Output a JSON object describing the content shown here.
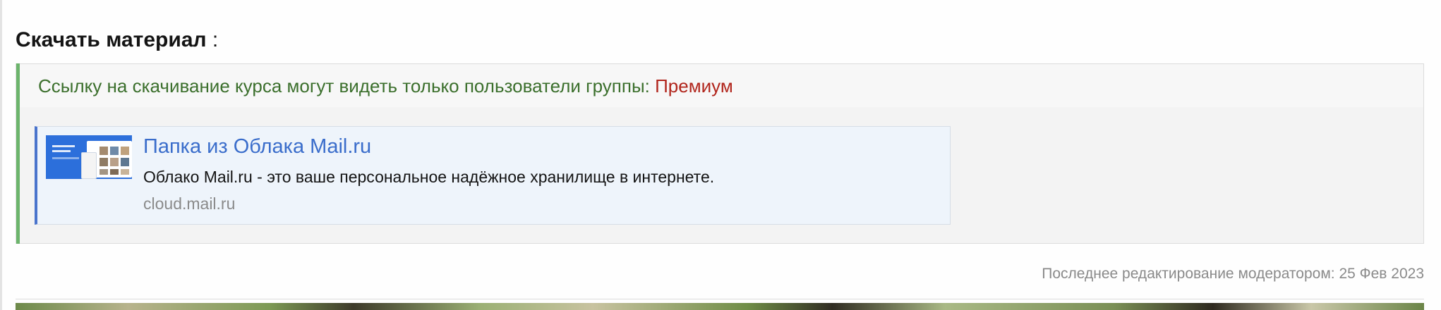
{
  "section": {
    "title": "Скачать материал",
    "title_suffix": " :"
  },
  "hidden_content": {
    "notice_text": "Ссылку на скачивание курса могут видеть только пользователи группы: ",
    "group_name": "Премиум"
  },
  "link_preview": {
    "title": "Папка из Облака Mail.ru",
    "description": "Облако Mail.ru - это ваше персональное надёжное хранилище в интернете.",
    "domain": "cloud.mail.ru",
    "thumbnail_icon": "cloud-preview-thumbnail"
  },
  "footer": {
    "last_edit": "Последнее редактирование модератором: 25 Фев 2023"
  },
  "colors": {
    "accent_green": "#6cb46c",
    "notice_text": "#3b6f2c",
    "group_red": "#b1251c",
    "link_blue": "#3a6dcb",
    "preview_bar": "#4a74cc"
  }
}
